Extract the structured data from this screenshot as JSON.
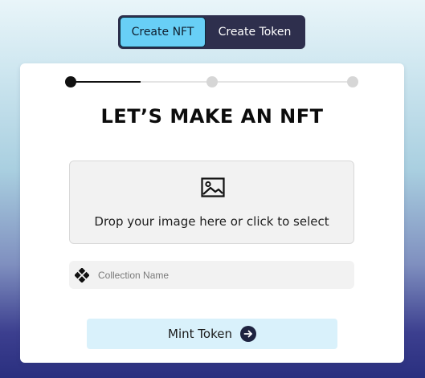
{
  "tabs": {
    "create_nft": "Create NFT",
    "create_token": "Create Token",
    "active": "create_nft"
  },
  "stepper": {
    "steps": 3,
    "current_step": 1
  },
  "heading": "LET’S MAKE AN NFT",
  "dropzone": {
    "icon": "image-icon",
    "text": "Drop your image here or click to select"
  },
  "collection": {
    "icon": "diamond-cluster-icon",
    "placeholder": "Collection Name",
    "value": ""
  },
  "mint_button": {
    "label": "Mint Token",
    "icon": "arrow-right-circle-icon"
  },
  "colors": {
    "active_tab": "#68cff6",
    "toggle_bg": "#2e2f4d",
    "mint_button_bg": "#d9f1fb",
    "arrow_circle": "#1e2340"
  }
}
